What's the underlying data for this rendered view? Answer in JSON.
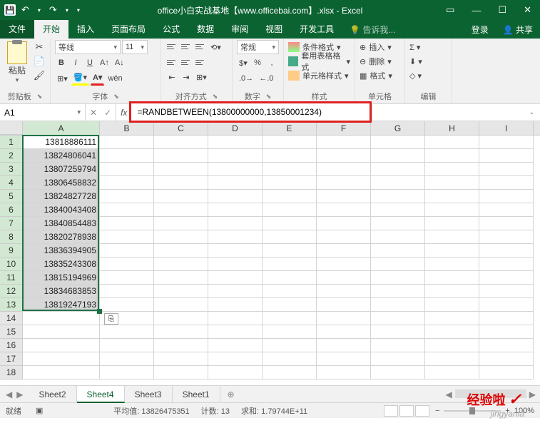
{
  "title": "office小白实战基地【www.officebai.com】.xlsx - Excel",
  "tabs": {
    "file": "文件",
    "home": "开始",
    "insert": "插入",
    "layout": "页面布局",
    "formulas": "公式",
    "data": "数据",
    "review": "审阅",
    "view": "视图",
    "dev": "开发工具",
    "tell": "告诉我...",
    "login": "登录",
    "share": "共享"
  },
  "ribbon": {
    "clipboard": {
      "paste": "粘贴",
      "label": "剪贴板"
    },
    "font": {
      "name": "等线",
      "size": "11",
      "label": "字体",
      "wen": "wén"
    },
    "align": {
      "label": "对齐方式"
    },
    "number": {
      "format": "常规",
      "label": "数字"
    },
    "styles": {
      "cond": "条件格式",
      "table": "套用表格格式",
      "cell": "单元格样式",
      "label": "样式"
    },
    "cells": {
      "insert": "插入",
      "delete": "删除",
      "format": "格式",
      "label": "单元格"
    },
    "editing": {
      "label": "编辑"
    }
  },
  "namebox": "A1",
  "formula": "=RANDBETWEEN(13800000000,13850001234)",
  "columns": [
    "A",
    "B",
    "C",
    "D",
    "E",
    "F",
    "G",
    "H",
    "I"
  ],
  "colA_width": 108,
  "other_col_width": 76,
  "data_cells": [
    "13818886111",
    "13824806041",
    "13807259794",
    "13806458832",
    "13824827728",
    "13840043408",
    "13840854483",
    "13820278938",
    "13836394905",
    "13835243308",
    "13815194969",
    "13834683853",
    "13819247193"
  ],
  "row_count": 18,
  "sheets": [
    "Sheet2",
    "Sheet4",
    "Sheet3",
    "Sheet1"
  ],
  "active_sheet": "Sheet4",
  "status": {
    "ready": "就绪",
    "avg_label": "平均值:",
    "avg": "13826475351",
    "count_label": "计数:",
    "count": "13",
    "sum_label": "求和:",
    "sum": "1.79744E+11",
    "zoom": "100%"
  },
  "watermark": "jingyanla"
}
